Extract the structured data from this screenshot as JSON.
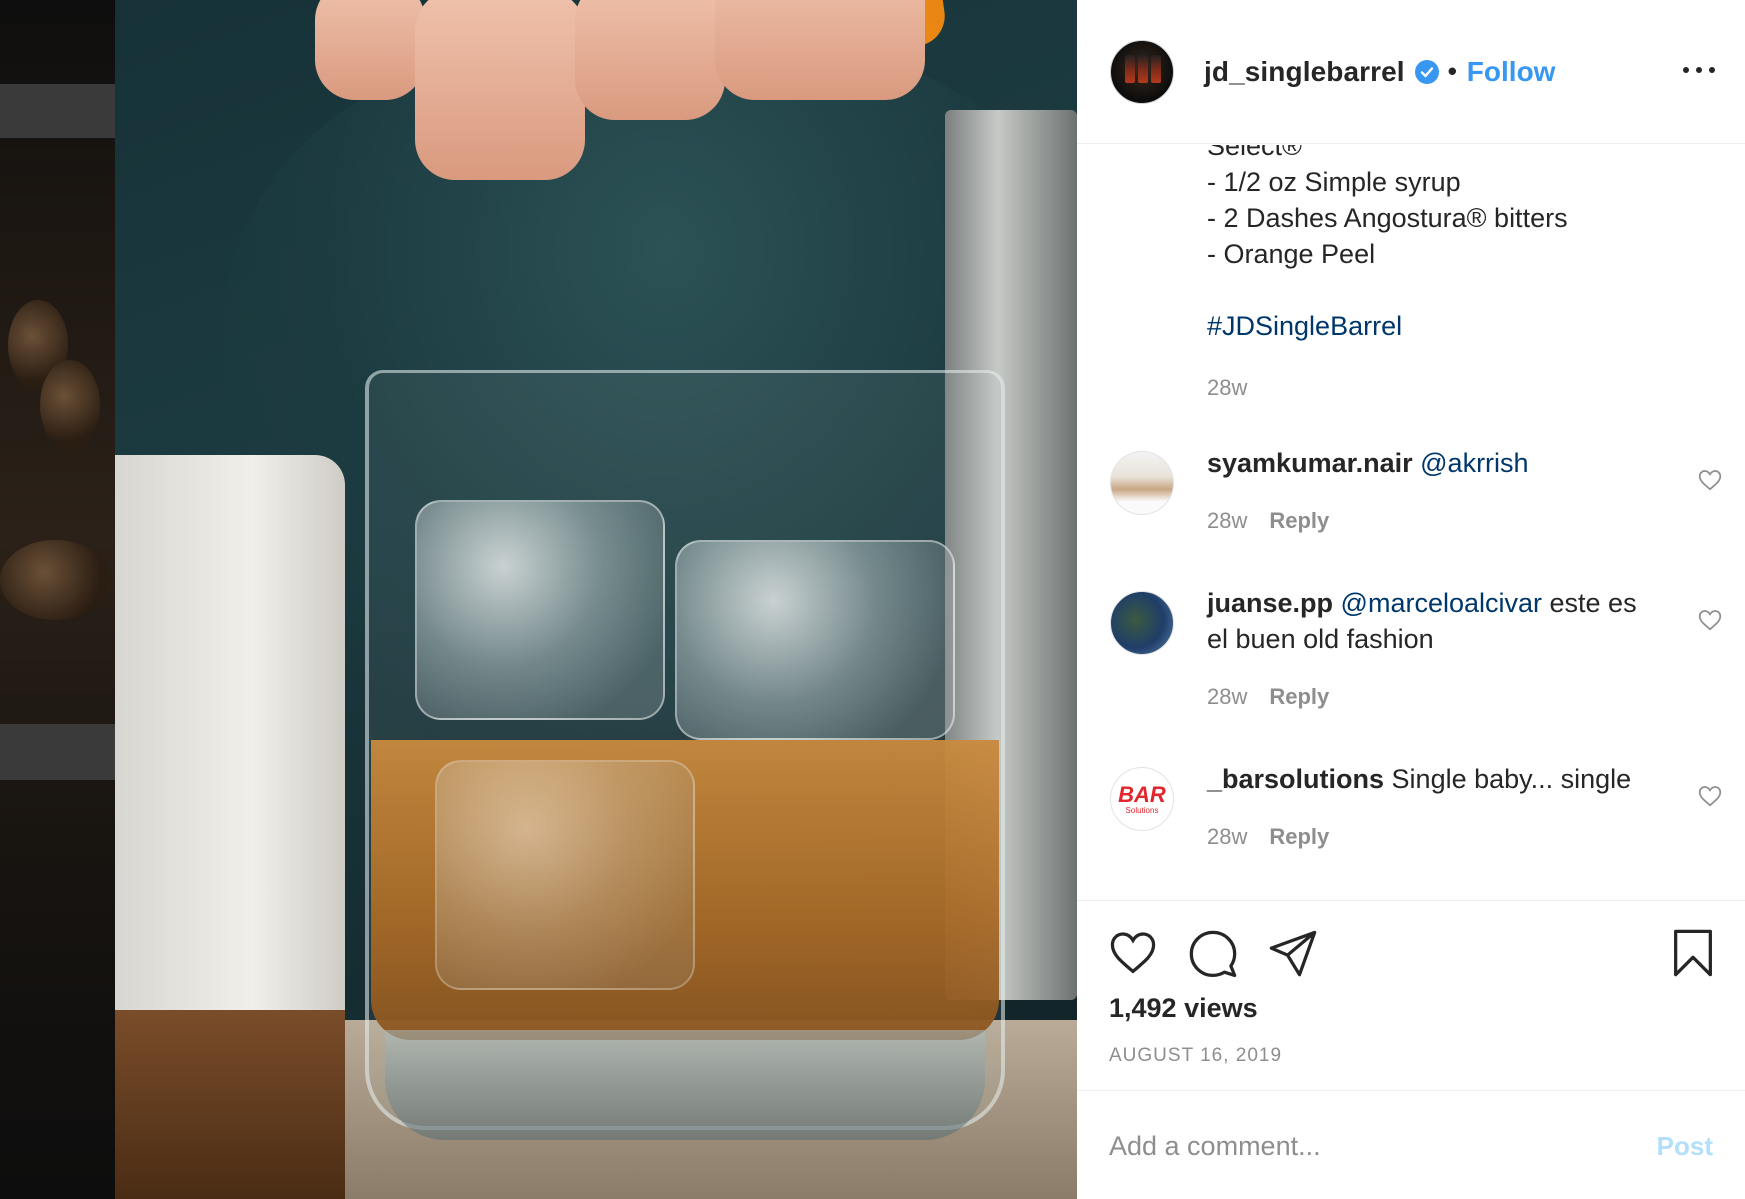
{
  "post": {
    "username": "jd_singlebarrel",
    "follow_label": "Follow",
    "dot_separator": "•"
  },
  "caption": {
    "lines": [
      "Select®",
      "- 1/2 oz Simple syrup",
      "- 2 Dashes Angostura® bitters",
      "- Orange Peel"
    ],
    "hashtag": "#JDSingleBarrel",
    "time": "28w"
  },
  "comments": [
    {
      "user": "syamkumar.nair",
      "mention": "@akrrish",
      "text": "",
      "text_line2": "",
      "time": "28w",
      "reply": "Reply"
    },
    {
      "user": "juanse.pp",
      "mention": "@marceloalcivar",
      "text": " este es",
      "text_line2": "el buen old fashion",
      "time": "28w",
      "reply": "Reply"
    },
    {
      "user": "_barsolutions",
      "mention": "",
      "text": "Single baby... single",
      "text_line2": "",
      "time": "28w",
      "reply": "Reply"
    }
  ],
  "bar_avatar_text": "BAR",
  "bar_avatar_subtext": "Solutions",
  "stats": {
    "views": "1,492 views",
    "date": "AUGUST 16, 2019"
  },
  "comment_box": {
    "placeholder": "Add a comment...",
    "post_label": "Post"
  },
  "colors": {
    "link_blue": "#3897f0",
    "mention_blue": "#00376b",
    "muted_gray": "#8e8e8e",
    "post_disabled": "#b2dffc"
  }
}
